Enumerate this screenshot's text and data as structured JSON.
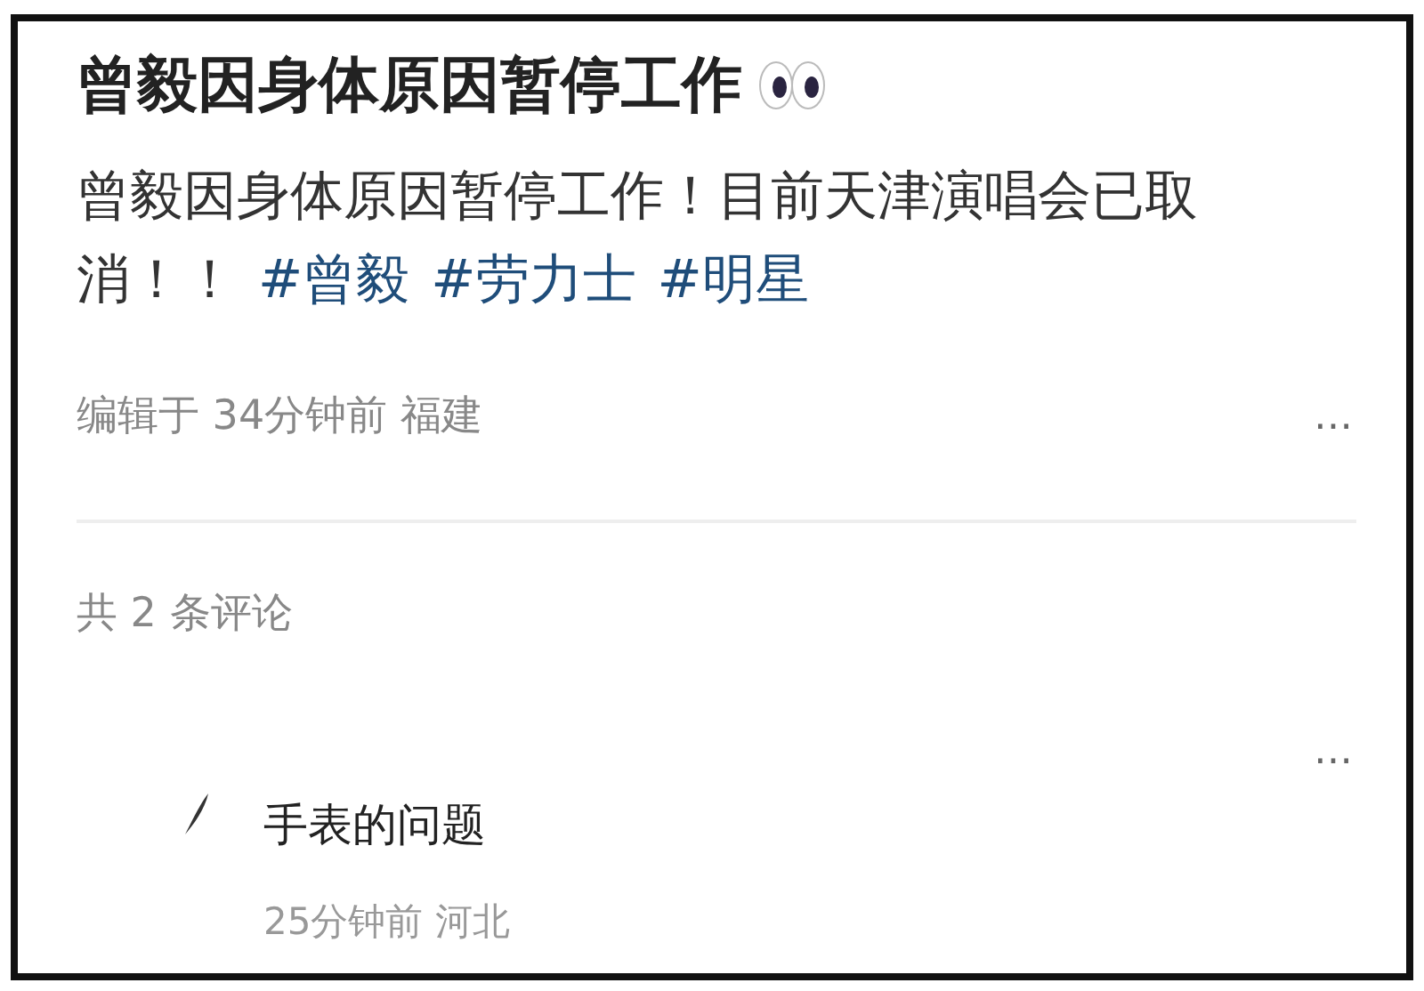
{
  "post": {
    "title": "曾毅因身体原因暂停工作",
    "text": "曾毅因身体原因暂停工作！目前天津演唱会已取消！！",
    "tags": [
      "#曾毅",
      "#劳力士",
      "#明星"
    ],
    "meta": "编辑于 34分钟前 福建",
    "more": "…"
  },
  "comments": {
    "count_label": "共 2 条评论",
    "more": "…",
    "items": [
      {
        "text": "手表的问题",
        "meta": "25分钟前 河北"
      }
    ]
  }
}
